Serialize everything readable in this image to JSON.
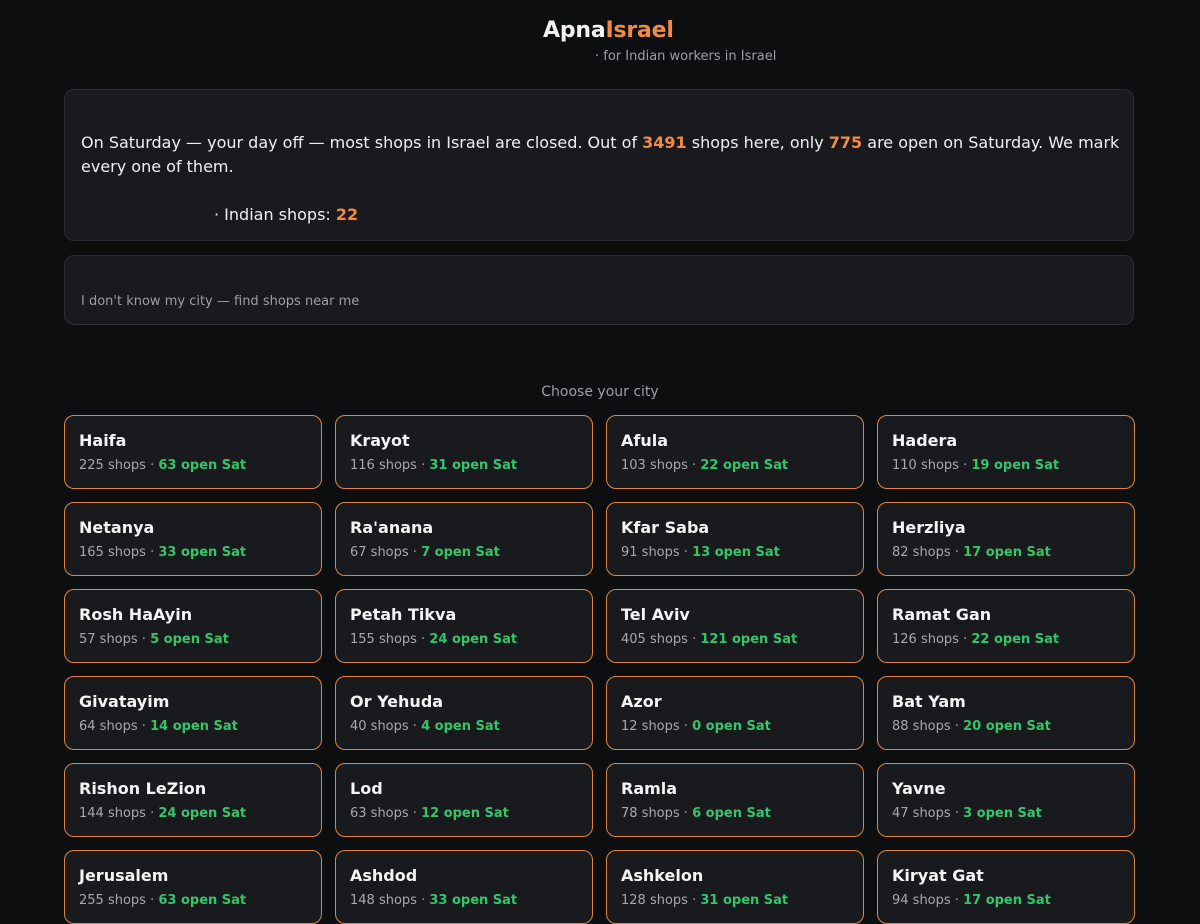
{
  "header": {
    "brand_part1": "Apna",
    "brand_part2": "Israel",
    "tagline": "· for Indian workers in Israel",
    "brand_color": "#f08a45"
  },
  "info": {
    "text_before_total": "On Saturday — your day off — most shops in Israel are closed. Out of ",
    "total_shops": "3491",
    "text_between": " shops here, only ",
    "open_saturday": "775",
    "text_after": " are open on Saturday. We mark every one of them.",
    "indian_label": "· Indian shops: ",
    "indian_count": "22"
  },
  "locate": {
    "label": "I don't know my city — find shops near me"
  },
  "cities_heading": "Choose your city",
  "colors": {
    "accent": "#f08a45",
    "card_border": "#e0843f",
    "open_green": "#34c46a",
    "background": "#0d0e10",
    "card_bg": "#181a1d"
  },
  "cities": [
    {
      "name": "Haifa",
      "shops": "225 shops",
      "open": "63 open Sat"
    },
    {
      "name": "Krayot",
      "shops": "116 shops",
      "open": "31 open Sat"
    },
    {
      "name": "Afula",
      "shops": "103 shops",
      "open": "22 open Sat"
    },
    {
      "name": "Hadera",
      "shops": "110 shops",
      "open": "19 open Sat"
    },
    {
      "name": "Netanya",
      "shops": "165 shops",
      "open": "33 open Sat"
    },
    {
      "name": "Ra'anana",
      "shops": "67 shops",
      "open": "7 open Sat"
    },
    {
      "name": "Kfar Saba",
      "shops": "91 shops",
      "open": "13 open Sat"
    },
    {
      "name": "Herzliya",
      "shops": "82 shops",
      "open": "17 open Sat"
    },
    {
      "name": "Rosh HaAyin",
      "shops": "57 shops",
      "open": "5 open Sat"
    },
    {
      "name": "Petah Tikva",
      "shops": "155 shops",
      "open": "24 open Sat"
    },
    {
      "name": "Tel Aviv",
      "shops": "405 shops",
      "open": "121 open Sat"
    },
    {
      "name": "Ramat Gan",
      "shops": "126 shops",
      "open": "22 open Sat"
    },
    {
      "name": "Givatayim",
      "shops": "64 shops",
      "open": "14 open Sat"
    },
    {
      "name": "Or Yehuda",
      "shops": "40 shops",
      "open": "4 open Sat"
    },
    {
      "name": "Azor",
      "shops": "12 shops",
      "open": "0 open Sat"
    },
    {
      "name": "Bat Yam",
      "shops": "88 shops",
      "open": "20 open Sat"
    },
    {
      "name": "Rishon LeZion",
      "shops": "144 shops",
      "open": "24 open Sat"
    },
    {
      "name": "Lod",
      "shops": "63 shops",
      "open": "12 open Sat"
    },
    {
      "name": "Ramla",
      "shops": "78 shops",
      "open": "6 open Sat"
    },
    {
      "name": "Yavne",
      "shops": "47 shops",
      "open": "3 open Sat"
    },
    {
      "name": "Jerusalem",
      "shops": "255 shops",
      "open": "63 open Sat"
    },
    {
      "name": "Ashdod",
      "shops": "148 shops",
      "open": "33 open Sat"
    },
    {
      "name": "Ashkelon",
      "shops": "128 shops",
      "open": "31 open Sat"
    },
    {
      "name": "Kiryat Gat",
      "shops": "94 shops",
      "open": "17 open Sat"
    }
  ]
}
